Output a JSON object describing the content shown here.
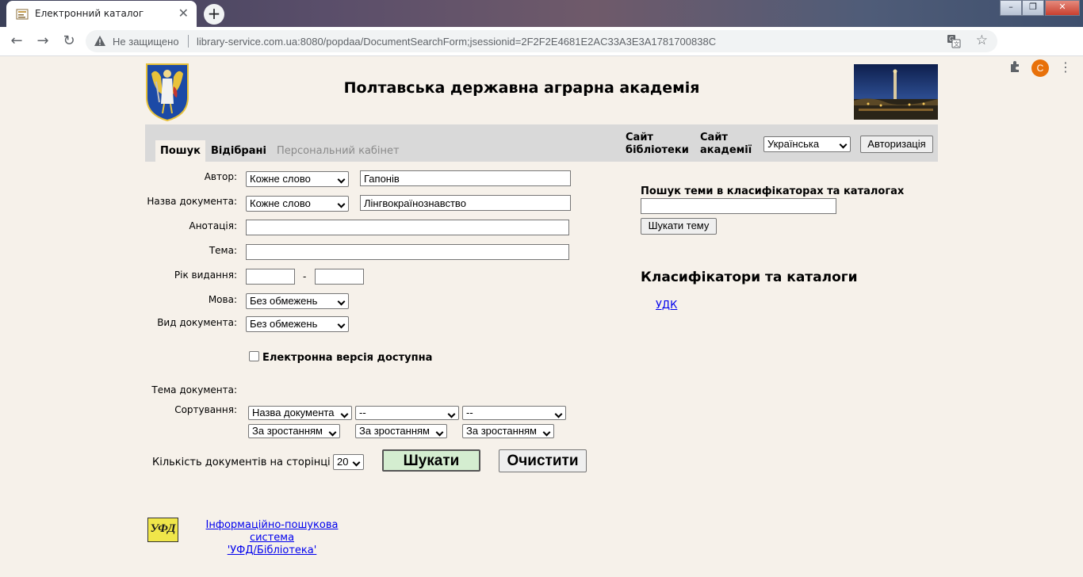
{
  "browser": {
    "tab_title": "Електронний каталог",
    "insecure_label": "Не защищено",
    "url": "library-service.com.ua:8080/popdaa/DocumentSearchForm;jsessionid=2F2F2E4681E2AC33A3E3A1781700838C",
    "profile_initial": "C"
  },
  "header": {
    "title": "Полтавська державна аграрна академія"
  },
  "nav": {
    "tabs": [
      "Пошук",
      "Відібрані",
      "Персональний кабінет"
    ],
    "library_site": [
      "Сайт",
      "бібліотеки"
    ],
    "academy_site": [
      "Сайт",
      "академії"
    ],
    "language": "Українська",
    "auth_button": "Авторизація"
  },
  "form": {
    "author_label": "Автор:",
    "author_mode": "Кожне слово",
    "author_value": "Гапонів",
    "title_label": "Назва документа:",
    "title_mode": "Кожне слово",
    "title_value": "Лінгвокраїнознавство",
    "annotation_label": "Анотація:",
    "subject_label": "Тема:",
    "year_label": "Рік видання:",
    "year_dash": "-",
    "language_label": "Мова:",
    "language_value": "Без обмежень",
    "doctype_label": "Вид документа:",
    "doctype_value": "Без обмежень",
    "electronic_label": "Електронна версія доступна",
    "doc_subject_label": "Тема документа:",
    "sort_label": "Сортування:",
    "sort_fields": [
      "Назва документа",
      "--",
      "--"
    ],
    "sort_orders": [
      "За зростанням",
      "За зростанням",
      "За зростанням"
    ],
    "per_page_label": "Кількість документів на сторінці",
    "per_page_value": "20",
    "search_button": "Шукати",
    "clear_button": "Очистити"
  },
  "right": {
    "topic_search_heading": "Пошук теми в класифікаторах та каталогах",
    "topic_search_button": "Шукати тему",
    "classifiers_heading": "Класифікатори та каталоги",
    "classifier_link": "УДК"
  },
  "footer": {
    "logo_text": "УФД",
    "system_link_line1": "Інформаційно-пошукова система",
    "system_link_line2": "'УФД/Бібліотека'"
  },
  "colors": {
    "page_bg": "#f6f1ea",
    "nav_strip": "#d9d9d9",
    "search_button_bg": "#d4edd0",
    "link": "#0000ee"
  }
}
